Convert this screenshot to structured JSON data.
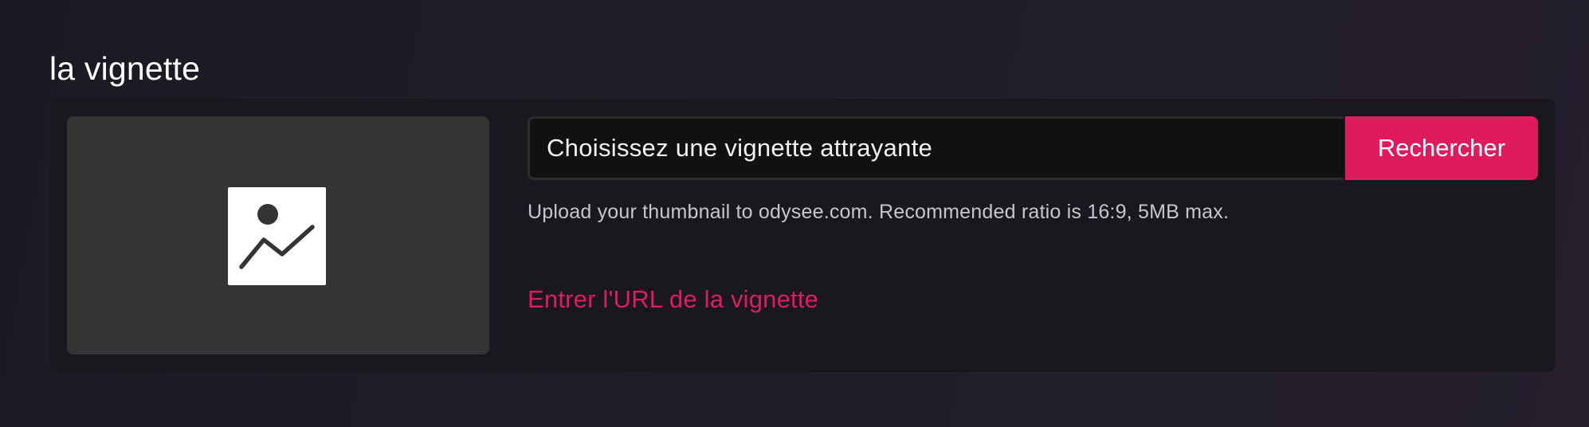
{
  "section": {
    "title": "la vignette"
  },
  "thumbnail": {
    "preview_icon": "image-placeholder-icon",
    "input_placeholder": "Choisissez une vignette attrayante",
    "search_label": "Rechercher",
    "help_text": "Upload your thumbnail to odysee.com. Recommended ratio is 16:9, 5MB max.",
    "url_link_label": "Entrer l'URL de la vignette"
  },
  "colors": {
    "accent": "#e01b5d",
    "card_background": "#1a181f",
    "preview_background": "#343434",
    "input_background": "#111111"
  }
}
